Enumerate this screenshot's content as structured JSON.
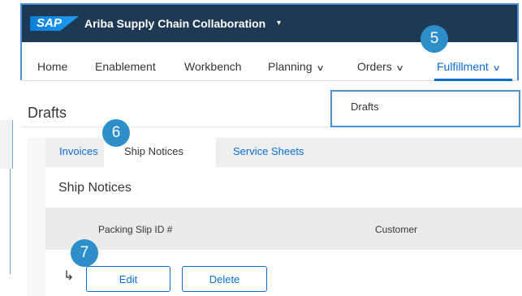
{
  "header": {
    "logo": "SAP",
    "app_title": "Ariba Supply Chain Collaboration",
    "app_caret": "▾"
  },
  "nav": {
    "items": [
      {
        "label": "Home"
      },
      {
        "label": "Enablement"
      },
      {
        "label": "Workbench"
      },
      {
        "label": "Planning"
      },
      {
        "label": "Orders"
      },
      {
        "label": "Fulfillment"
      }
    ],
    "chevron": "∨"
  },
  "page": {
    "title": "Drafts"
  },
  "fulfillment_menu": {
    "items": [
      {
        "label": "Drafts"
      }
    ]
  },
  "tabs": [
    {
      "label": "Invoices"
    },
    {
      "label": "Ship Notices"
    },
    {
      "label": "Service Sheets"
    }
  ],
  "section": {
    "title": "Ship Notices"
  },
  "table": {
    "columns": [
      "Packing Slip ID #",
      "Customer"
    ]
  },
  "actions": {
    "row_arrow": "↳",
    "edit_label": "Edit",
    "delete_label": "Delete"
  },
  "badges": [
    "5",
    "6",
    "7"
  ],
  "colors": {
    "header_bg": "#1e3954",
    "accent": "#0a6ed1",
    "badge": "#2d8ec9",
    "highlight_border": "#4a8fd8"
  }
}
